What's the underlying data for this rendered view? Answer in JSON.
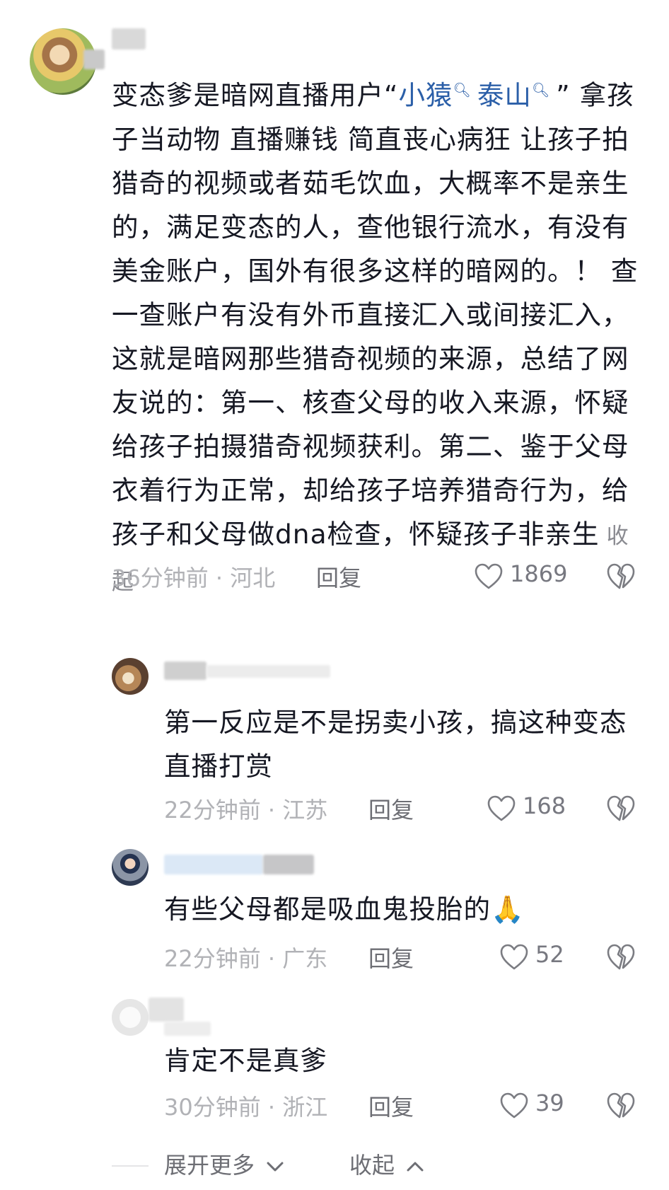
{
  "main_comment": {
    "text_before": "变态爹是暗网直播用户“",
    "link_1": "小猿",
    "link_2": "泰山",
    "text_after": "” 拿孩子当动物 直播赚钱 简直丧心病狂 让孩子拍猎奇的视频或者茹毛饮血，大概率不是亲生的，满足变态的人，查他银行流水，有没有美金账户，国外有很多这样的暗网的。！ 查一查账户有没有外币直接汇入或间接汇入，这就是暗网那些猎奇视频的来源，总结了网友说的：第一、核查父母的收入来源，怀疑给孩子拍摄猎奇视频获利。第二、鉴于父母衣着行为正常，却给孩子培养猎奇行为，给孩子和父母做dna检查，怀疑孩子非亲生",
    "collapse_label": "收起",
    "meta": "36分钟前 · 河北",
    "reply_label": "回复",
    "likes": "1869"
  },
  "replies": [
    {
      "text": "第一反应是不是拐卖小孩，搞这种变态直播打赏",
      "meta": "22分钟前 · 江苏",
      "reply_label": "回复",
      "likes": "168"
    },
    {
      "text": "有些父母都是吸血鬼投胎的🙏",
      "meta": "22分钟前 · 广东",
      "reply_label": "回复",
      "likes": "52"
    },
    {
      "text": "肯定不是真爹",
      "meta": "30分钟前 · 浙江",
      "reply_label": "回复",
      "likes": "39"
    }
  ],
  "footer": {
    "expand_more": "展开更多",
    "collapse": "收起"
  },
  "icons": {
    "like": "heart-outline-icon",
    "dislike": "broken-heart-icon",
    "search_hint": "search-magnifier-icon"
  },
  "colors": {
    "link": "#2b5fa8",
    "text": "#161823",
    "meta": "#b1b2b6"
  }
}
